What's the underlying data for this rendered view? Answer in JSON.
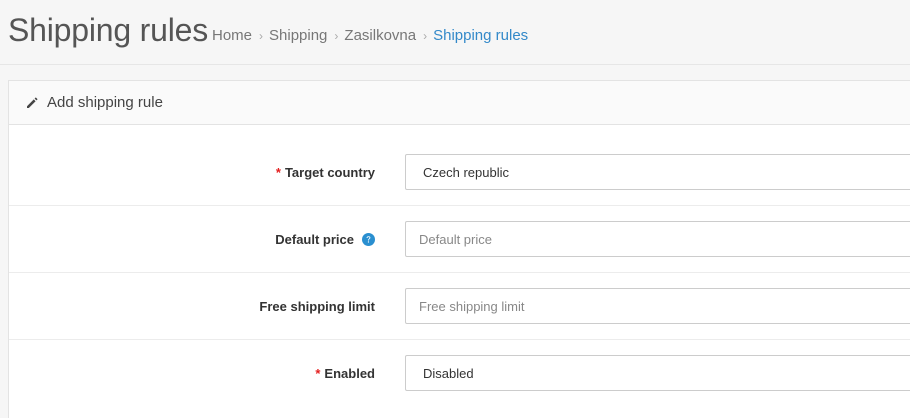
{
  "header": {
    "title": "Shipping rules",
    "breadcrumb": [
      {
        "label": "Home"
      },
      {
        "label": "Shipping"
      },
      {
        "label": "Zasilkovna"
      },
      {
        "label": "Shipping rules"
      }
    ],
    "breadcrumb_separator": "›"
  },
  "panel": {
    "heading": "Add shipping rule",
    "heading_icon": "pencil-icon"
  },
  "form": {
    "target_country": {
      "label": "Target country",
      "required_mark": "*",
      "value": "Czech republic"
    },
    "default_price": {
      "label": "Default price",
      "placeholder": "Default price",
      "help_icon": "question-circle-icon"
    },
    "free_shipping_limit": {
      "label": "Free shipping limit",
      "placeholder": "Free shipping limit"
    },
    "enabled": {
      "label": "Enabled",
      "required_mark": "*",
      "value": "Disabled"
    }
  },
  "colors": {
    "accent": "#3389c9",
    "required": "#e41e1e",
    "help_icon": "#2a8fd0"
  }
}
